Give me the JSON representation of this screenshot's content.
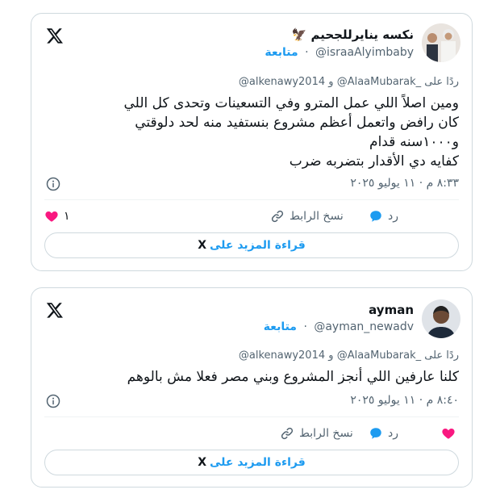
{
  "colors": {
    "accent": "#1d9bf0",
    "heart": "#f91880",
    "muted": "#536471",
    "border": "#cfd9de"
  },
  "tweets": [
    {
      "author": {
        "name": "نكسه ينايرللجحيم",
        "emoji": "🦅",
        "handle": "@israaAlyimbaby",
        "follow": "متابعة"
      },
      "reply_prefix": "ردًا على",
      "reply_to": "@AlaaMubarak_",
      "reply_and": "و",
      "reply_to_2": "@alkenawy2014",
      "text": "ومين اصلاً اللي عمل المترو وفي التسعينات وتحدى كل اللي\nكان رافض واتعمل أعظم مشروع بنستفيد منه لحد دلوقتي\nو١٠٠٠سنه قدام\nكفايه دي الأقدار بتضربه ضرب",
      "timestamp": "٨:٣٣ م · ١١ يوليو ٢٠٢٥",
      "likes": "١",
      "reply_label": "رد",
      "copy_link_label": "نسخ الرابط",
      "read_more": "قراءة المزيد على",
      "read_more_x": "X",
      "icons": [
        "x-logo-icon",
        "info-icon",
        "heart-icon",
        "reply-icon",
        "link-icon"
      ]
    },
    {
      "author": {
        "name": "ayman",
        "handle": "@ayman_newadv",
        "follow": "متابعة"
      },
      "reply_prefix": "ردًا على",
      "reply_to": "@AlaaMubarak_",
      "reply_and": "و",
      "reply_to_2": "@alkenawy2014",
      "text": "كلنا عارفين اللي أنجز المشروع وبني مصر فعلا مش بالوهم",
      "timestamp": "٨:٤٠ م · ١١ يوليو ٢٠٢٥",
      "reply_label": "رد",
      "copy_link_label": "نسخ الرابط",
      "read_more": "قراءة المزيد على",
      "read_more_x": "X",
      "icons": [
        "x-logo-icon",
        "info-icon",
        "heart-icon",
        "reply-icon",
        "link-icon"
      ]
    }
  ]
}
